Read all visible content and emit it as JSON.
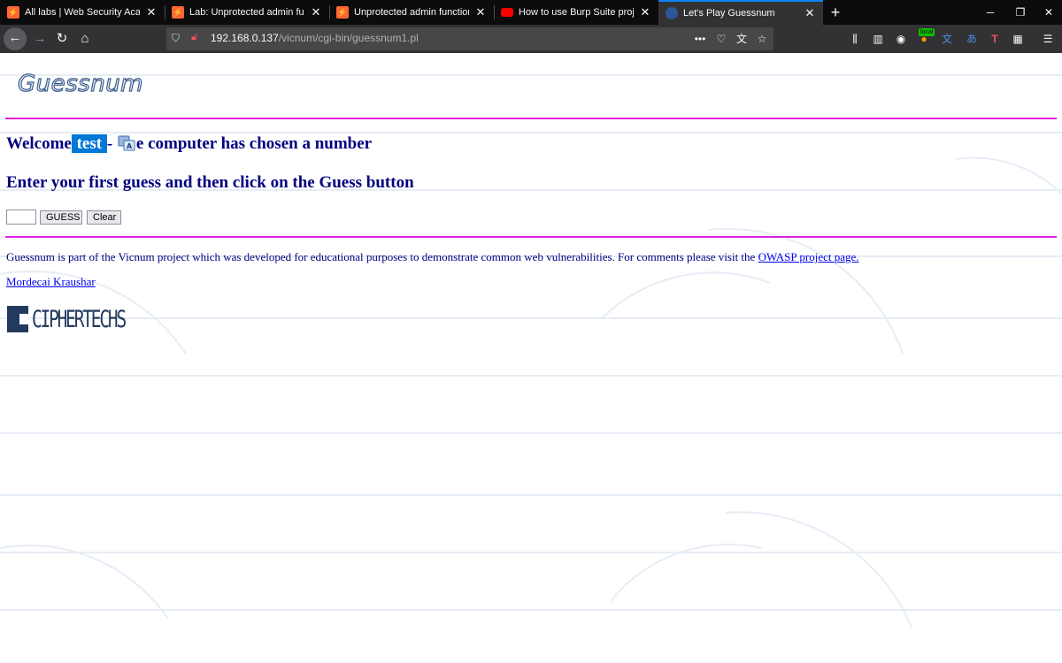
{
  "browser": {
    "tabs": [
      {
        "title": "All labs | Web Security Academ",
        "favicon": "portswigger-icon",
        "active": false
      },
      {
        "title": "Lab: Unprotected admin functio",
        "favicon": "portswigger-icon",
        "active": false
      },
      {
        "title": "Unprotected admin functionalit",
        "favicon": "portswigger-icon",
        "active": false
      },
      {
        "title": "How to use Burp Suite projects",
        "favicon": "youtube-icon",
        "active": false
      },
      {
        "title": "Let's Play Guessnum",
        "favicon": "globe-icon",
        "active": true
      }
    ],
    "url_host": "192.168.0.137",
    "url_path": "/vicnum/cgi-bin/guessnum1.pl",
    "extension_badge": "local",
    "accent_color": "#0a84ff"
  },
  "page": {
    "logo_text": "Guessnum",
    "welcome_prefix": "Welcome",
    "username": "test",
    "welcome_dash": "-",
    "welcome_suffix": "e computer has chosen a number",
    "instruction": "Enter your first guess and then click on the Guess button",
    "guess_value": "",
    "guess_button": "GUESS",
    "clear_button": "Clear",
    "footer_text": "Guessnum is part of the Vicnum project which was developed for educational purposes to demonstrate common web vulnerabilities. For comments please visit the",
    "footer_link": "OWASP project page.",
    "author_link": "Mordecai Kraushar",
    "sponsor_logo": "CIPHERTECHS",
    "heading_color": "#000080",
    "rule_color": "#e020e0",
    "selection_color": "#0078d7"
  }
}
